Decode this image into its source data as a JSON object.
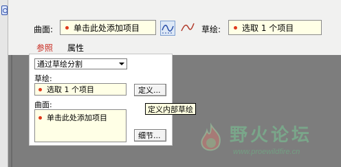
{
  "dashboard": {
    "surface_label": "曲面:",
    "surface_collector": "单击此处添加项目",
    "sketch_label": "草绘:",
    "sketch_collector": "选取 1 个项目",
    "tabs": [
      {
        "label": "参照",
        "active": true
      },
      {
        "label": "属性",
        "active": false
      }
    ],
    "icons": [
      "tool-strip-icon",
      "sketch-curve-option-icon",
      "freeform-curve-option-icon"
    ]
  },
  "references_panel": {
    "split_type_value": "通过草绘分割",
    "sketch_label": "草绘:",
    "sketch_value": "选取 1 个项目",
    "define_button": "定义...",
    "tooltip": "定义内部草绘",
    "surface_label": "曲面:",
    "surface_value": "单击此处添加项目",
    "details_button": "细节..."
  },
  "watermark": {
    "title": "野火论坛",
    "url": "www.proewildfire.cn"
  },
  "colors": {
    "collector_bg": "#ffffe6",
    "bullet": "#e0391b",
    "active_tab": "#c8281e",
    "model_area": "#7d7d7d"
  }
}
